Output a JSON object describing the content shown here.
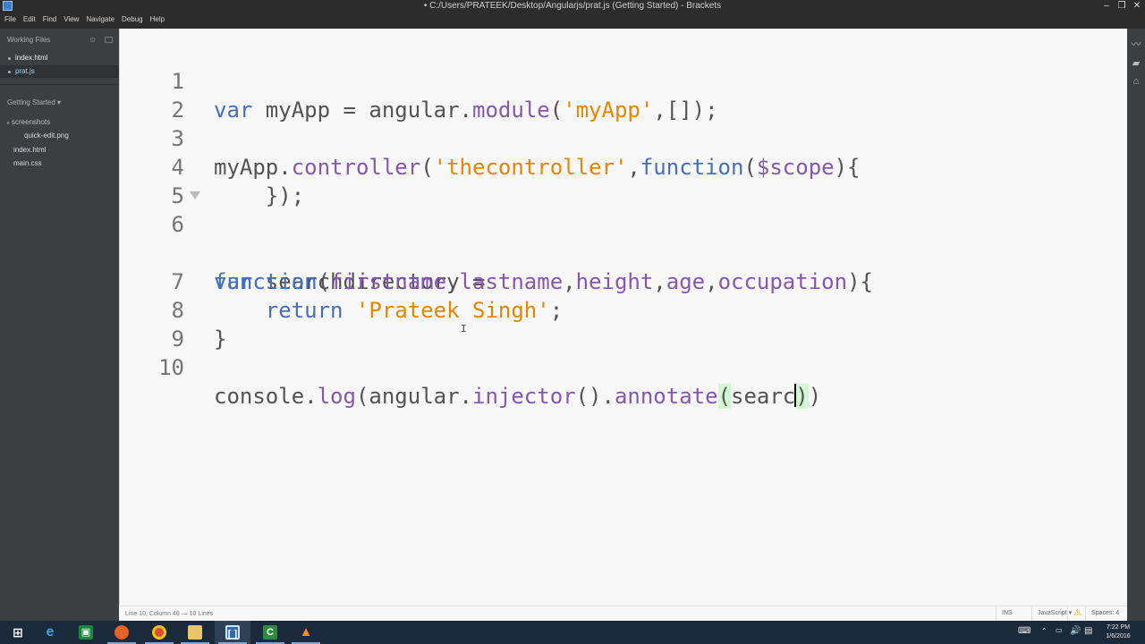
{
  "window": {
    "title": "• C:/Users/PRATEEK/Desktop/Angularjs/prat.js (Getting Started) - Brackets",
    "minimize": "–",
    "maximize": "❐",
    "close": "✕"
  },
  "menu": [
    "File",
    "Edit",
    "Find",
    "View",
    "Navigate",
    "Debug",
    "Help"
  ],
  "sidebar": {
    "working_files_title": "Working Files",
    "working_files": [
      {
        "name": "index.html",
        "active": false
      },
      {
        "name": "prat.js",
        "active": true
      }
    ],
    "project_title": "Getting Started ▾",
    "tree": {
      "folder": "screenshots",
      "folder_child": "quick-edit.png",
      "files": [
        "index.html",
        "main.css"
      ]
    }
  },
  "editor": {
    "line_numbers": [
      "1",
      "2",
      "3",
      "4",
      "5",
      "6",
      "",
      "7",
      "8",
      "9",
      "10"
    ],
    "lines": {
      "l1": {
        "kw": "var",
        "a": " myApp = angular.",
        "fn": "module",
        "b": "(",
        "str": "'myApp'",
        "c": ",[]);"
      },
      "l3": {
        "a": "myApp.",
        "fn": "controller",
        "b": "(",
        "str": "'thecontroller'",
        "c": ",",
        "kw": "function",
        "d": "(",
        "fn2": "$scope",
        "e": "){"
      },
      "l4": {
        "a": "    });"
      },
      "l6": {
        "kw": "var",
        "a": " searchdirectory ="
      },
      "l6b": {
        "kw": "function",
        "a": "(",
        "p1": "firstname",
        "c1": ",",
        "p2": "lastname",
        "c2": ",",
        "p3": "height",
        "c3": ",",
        "p4": "age",
        "c4": ",",
        "p5": "occupation",
        "e": "){"
      },
      "l7": {
        "a": "    ",
        "kw": "return",
        "sp": " ",
        "str": "'Prateek Singh'",
        "e": ";"
      },
      "l8": {
        "a": "}"
      },
      "l10": {
        "a": "console.",
        "fn": "log",
        "b": "(angular.",
        "fn2": "injector",
        "c": "().",
        "fn3": "annotate",
        "d": "(",
        "e": "searc",
        "f": ")",
        "g": ")"
      }
    }
  },
  "statusbar": {
    "position": "Line 10, Column 46",
    "separator": " — ",
    "lines": "10 Lines",
    "mode": "INS",
    "language": "JavaScript ▾",
    "warning": "⚠",
    "spaces": "Spaces: 4"
  },
  "taskbar": {
    "clock_time": "7:22 PM",
    "clock_date": "1/6/2016",
    "apps": [
      "start-icon",
      "ie-icon",
      "store-icon",
      "firefox-icon",
      "chrome-icon",
      "explorer-icon",
      "brackets-icon",
      "camtasia-icon",
      "vlc-icon"
    ]
  },
  "colors": {
    "keyword": "#446fbd",
    "string": "#e88501",
    "function": "#8757ad",
    "text": "#535353",
    "sidebar": "#3c3f41",
    "taskbar": "#1b2a3a"
  }
}
